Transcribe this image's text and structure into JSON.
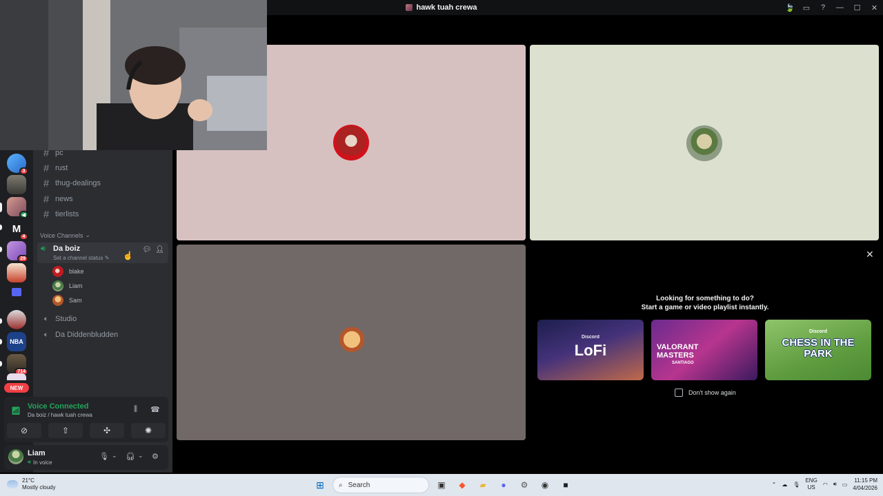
{
  "window": {
    "title": "hawk tuah crewa"
  },
  "rail": {
    "badges": [
      "3",
      "4",
      "29",
      "714"
    ],
    "new_label": "NEW"
  },
  "channels": {
    "text": [
      "pc",
      "rust",
      "thug-dealings",
      "news",
      "tierlists"
    ],
    "voice_category": "Voice Channels",
    "active_voice": {
      "name": "Da boiz",
      "status_placeholder": "Set a channel status",
      "members": [
        "blake",
        "Liam",
        "Sam"
      ]
    },
    "other_voice": [
      "Studio",
      "Da Diddenbludden"
    ]
  },
  "voice_panel": {
    "title": "Voice Connected",
    "subtitle": "Da boiz / hawk tuah crewa"
  },
  "user": {
    "name": "Liam",
    "status": "In voice"
  },
  "activity": {
    "heading_line1": "Looking for something to do?",
    "heading_line2": "Start a game or video playlist instantly.",
    "cards": [
      {
        "name": "LoFi",
        "brand": "Discord"
      },
      {
        "name": "VALORANT MASTERS",
        "sub": "SANTIAGO"
      },
      {
        "name": "CHESS IN THE PARK",
        "brand": "Discord"
      }
    ],
    "dont_show": "Don't show again"
  },
  "taskbar": {
    "temp": "21°C",
    "weather": "Mostly cloudy",
    "search_placeholder": "Search",
    "lang_top": "ENG",
    "lang_bottom": "US",
    "time": "11:15 PM",
    "date": "4/04/2026"
  },
  "colors": {
    "accent_green": "#23a55a",
    "tile_pink": "#d7c1c0",
    "tile_sage": "#dbe0cf",
    "tile_taupe": "#716967"
  }
}
